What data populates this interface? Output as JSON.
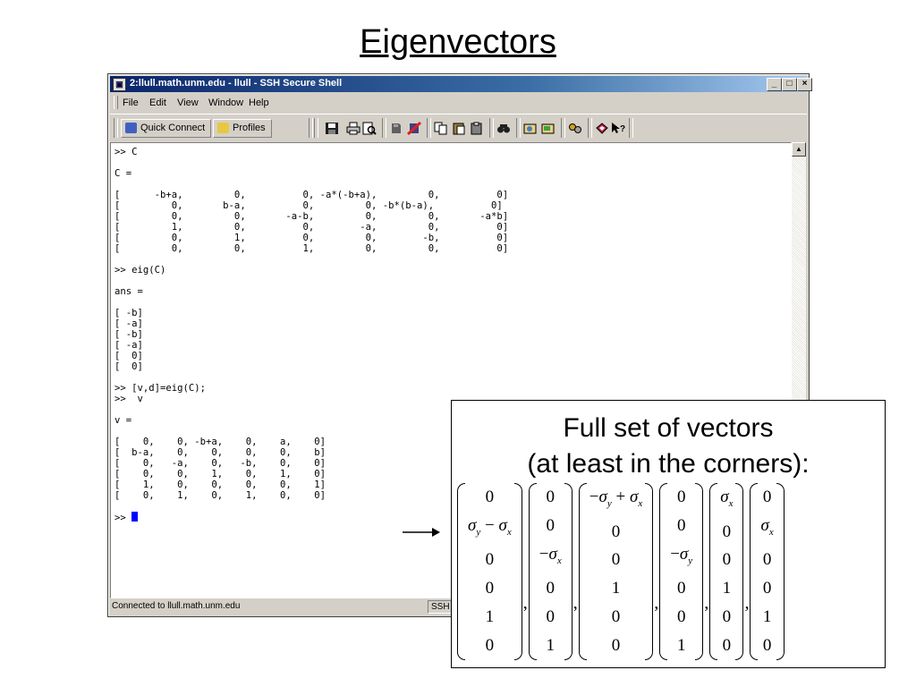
{
  "slide": {
    "title": "Eigenvectors"
  },
  "window": {
    "title": "2:llull.math.unm.edu - llull - SSH Secure Shell",
    "app_icon": "terminal-icon",
    "controls": {
      "minimize": "_",
      "maximize": "□",
      "close": "×"
    }
  },
  "menu": [
    "File",
    "Edit",
    "View",
    "Window",
    "Help"
  ],
  "toolbar": {
    "quick_connect": "Quick Connect",
    "profiles": "Profiles",
    "icons": [
      "save-icon",
      "print-icon",
      "print-preview-icon",
      "transfer-icon",
      "disconnect-icon",
      "copy-icon",
      "paste-icon",
      "paste-special-icon",
      "find-icon",
      "settings-icon",
      "new-window-icon",
      "keys-icon",
      "help-book-icon",
      "whats-this-icon"
    ]
  },
  "terminal": {
    "lines": [
      ">> C",
      "",
      "C =",
      "",
      "[      -b+a,         0,          0, -a*(-b+a),         0,          0]",
      "[         0,       b-a,          0,         0, -b*(b-a),          0]",
      "[         0,         0,       -a-b,         0,         0,       -a*b]",
      "[         1,         0,          0,        -a,         0,          0]",
      "[         0,         1,          0,         0,        -b,          0]",
      "[         0,         0,          1,         0,         0,          0]",
      "",
      ">> eig(C)",
      "",
      "ans =",
      "",
      "[ -b]",
      "[ -a]",
      "[ -b]",
      "[ -a]",
      "[  0]",
      "[  0]",
      "",
      ">> [v,d]=eig(C);",
      ">>  v",
      "",
      "v =",
      "",
      "[    0,    0, -b+a,    0,    a,    0]",
      "[  b-a,    0,    0,    0,    0,    b]",
      "[    0,   -a,    0,   -b,    0,    0]",
      "[    0,    0,    1,    0,    1,    0]",
      "[    1,    0,    0,    0,    0,    1]",
      "[    0,    1,    0,    1,    0,    0]",
      ""
    ],
    "prompt": ">> "
  },
  "status": {
    "text": "Connected to llull.math.unm.edu",
    "pane": "SSH"
  },
  "callout": {
    "title_line1": "Full set of vectors",
    "title_line2": "(at least in the corners):"
  }
}
